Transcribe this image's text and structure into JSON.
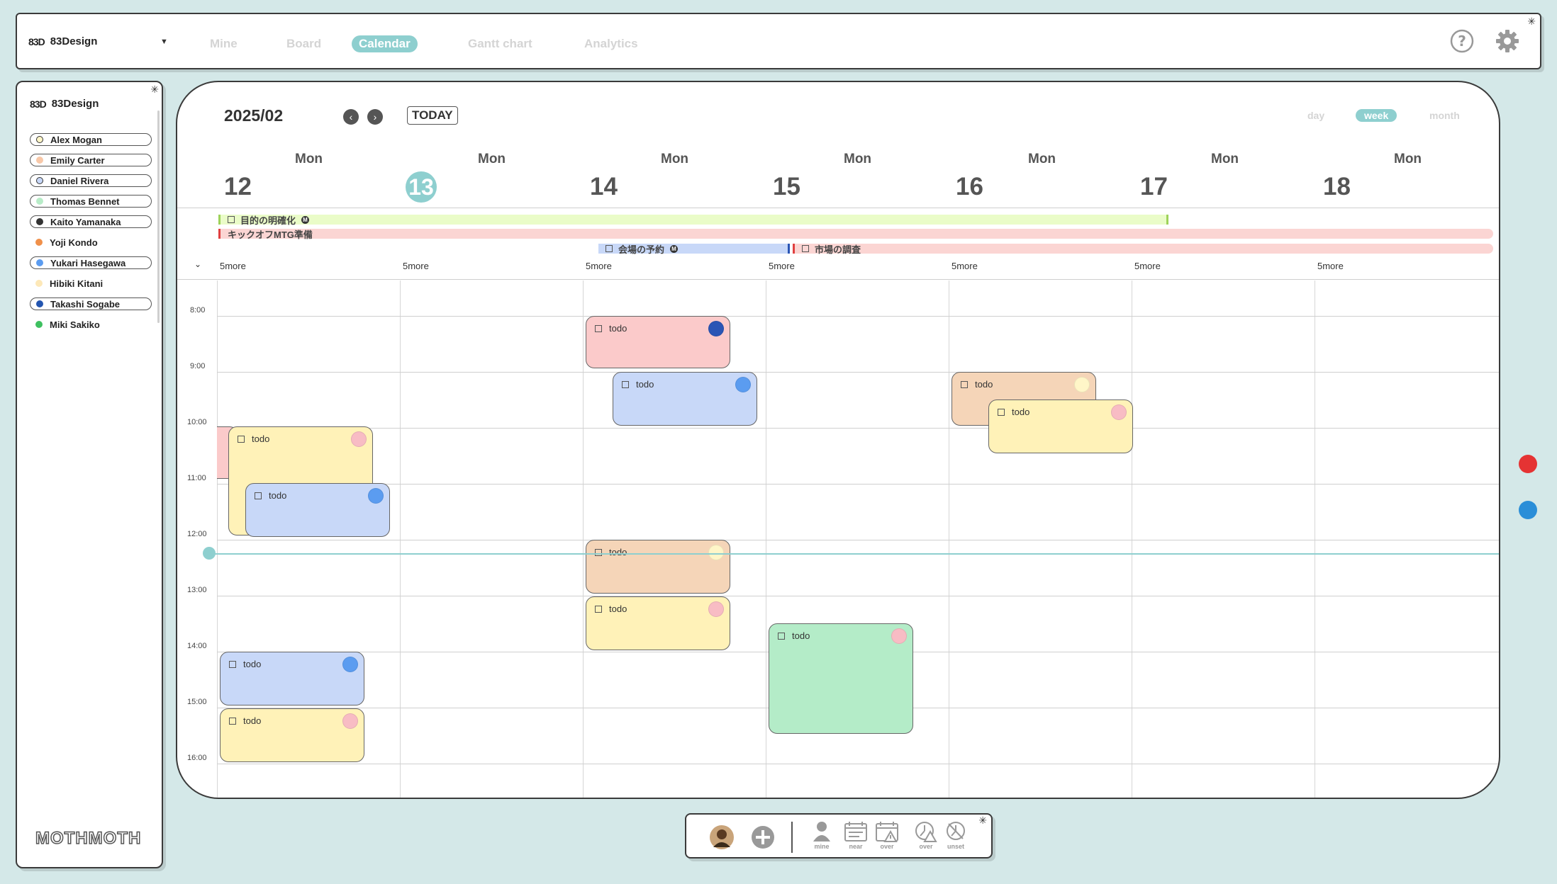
{
  "header": {
    "workspace_logo": "83D",
    "workspace_name": "83Design",
    "tabs": [
      {
        "label": "Mine"
      },
      {
        "label": "Board"
      },
      {
        "label": "Calendar"
      },
      {
        "label": "Gantt chart"
      },
      {
        "label": "Analytics"
      }
    ],
    "active_tab": "Calendar",
    "star": "✳"
  },
  "sidebar": {
    "logo": "83D",
    "title": "83Design",
    "members": [
      {
        "name": "Alex Mogan",
        "color": "#fff6c8",
        "style": "boxed-ring"
      },
      {
        "name": "Emily Carter",
        "color": "#f8c8a8",
        "style": "boxed"
      },
      {
        "name": "Daniel Rivera",
        "color": "#c8d8f8",
        "style": "boxed-ring"
      },
      {
        "name": "Thomas Bennet",
        "color": "#b8ecc8",
        "style": "boxed"
      },
      {
        "name": "Kaito Yamanaka",
        "color": "#333333",
        "style": "boxed"
      },
      {
        "name": "Yoji Kondo",
        "color": "#f0904a",
        "style": "plain"
      },
      {
        "name": "Yukari Hasegawa",
        "color": "#5b9cf0",
        "style": "boxed"
      },
      {
        "name": "Hibiki Kitani",
        "color": "#fde8b8",
        "style": "plain"
      },
      {
        "name": "Takashi Sogabe",
        "color": "#2355b0",
        "style": "boxed"
      },
      {
        "name": "Miki Sakiko",
        "color": "#3ec060",
        "style": "plain"
      }
    ],
    "footer_logo": "MOTHMOTH"
  },
  "calendar": {
    "month_label": "2025/02",
    "prev_label": "‹",
    "next_label": "›",
    "today_label": "TODAY",
    "views": [
      {
        "label": "day"
      },
      {
        "label": "week"
      },
      {
        "label": "month"
      }
    ],
    "active_view": "week",
    "days": [
      {
        "dow": "Mon",
        "num": "12"
      },
      {
        "dow": "Mon",
        "num": "13",
        "today": true
      },
      {
        "dow": "Mon",
        "num": "14"
      },
      {
        "dow": "Mon",
        "num": "15"
      },
      {
        "dow": "Mon",
        "num": "16"
      },
      {
        "dow": "Mon",
        "num": "17"
      },
      {
        "dow": "Mon",
        "num": "18"
      }
    ],
    "allday_events": [
      {
        "title": "目的の明確化",
        "color": "#eafcc8",
        "bar": "#9ed25a",
        "icon": "M"
      },
      {
        "title": "キックオフMTG準備",
        "color": "#fbd5d3",
        "bar": "#e04040"
      },
      {
        "title": "会場の予約",
        "color": "#c8d8f8",
        "icon": "M"
      },
      {
        "title": "市場の調査",
        "color": "#fbd5d3",
        "bar": "#e04040"
      }
    ],
    "more_label": "5more",
    "time_labels": [
      "8:00",
      "9:00",
      "10:00",
      "11:00",
      "12:00",
      "13:00",
      "14:00",
      "15:00",
      "16:00"
    ],
    "event_label": "todo",
    "events": [
      {
        "label": "todo",
        "fill": "#fbcaca",
        "dot": "#2a55b5"
      },
      {
        "label": "todo",
        "fill": "#c8d8f8",
        "dot": "#5b9cf0"
      },
      {
        "label": "todo",
        "fill": "#f5d5b8",
        "dot": "#fff6c8"
      },
      {
        "label": "todo",
        "fill": "#fff2b8",
        "dot": "#f8bcc4"
      },
      {
        "label": "todo",
        "fill": "#fff2b8",
        "dot": "#f8bcc4"
      },
      {
        "label": "todo",
        "fill": "#c8d8f8",
        "dot": "#5b9cf0"
      },
      {
        "label": "todo",
        "fill": "#f5d5b8",
        "dot": "#fff6c8"
      },
      {
        "label": "todo",
        "fill": "#fff2b8",
        "dot": "#f8bcc4"
      },
      {
        "label": "todo",
        "fill": "#b4ecc8",
        "dot": "#f8bcc4"
      },
      {
        "label": "todo",
        "fill": "#c8d8f8",
        "dot": "#5b9cf0"
      },
      {
        "label": "todo",
        "fill": "#fff2b8",
        "dot": "#f8bcc4"
      }
    ]
  },
  "right_dots": [
    {
      "color": "#e53333"
    },
    {
      "color": "#2a8ed8"
    }
  ],
  "toolbar": {
    "items": [
      {
        "label": "mine"
      },
      {
        "label": "near"
      },
      {
        "label": "over"
      },
      {
        "label": "over"
      },
      {
        "label": "unset"
      }
    ]
  },
  "colors": {
    "accent": "#8ecfcf",
    "background": "#d4e8e8"
  }
}
